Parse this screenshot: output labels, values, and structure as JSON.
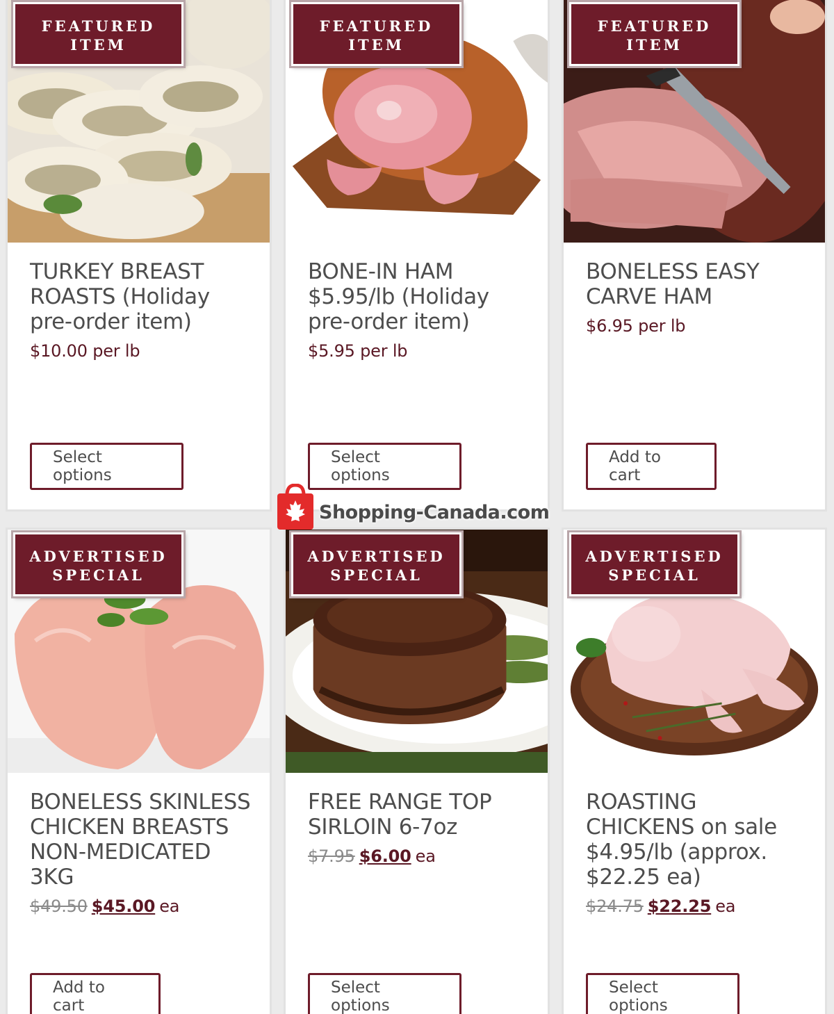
{
  "products": [
    {
      "badge": [
        "FEATURED",
        "ITEM"
      ],
      "title": "TURKEY BREAST ROASTS (Holiday pre-order item)",
      "price": "$10.00 per lb",
      "button": "Select options"
    },
    {
      "badge": [
        "FEATURED",
        "ITEM"
      ],
      "title": "BONE-IN HAM $5.95/lb (Holiday pre-order item)",
      "price": "$5.95 per lb",
      "button": "Select options"
    },
    {
      "badge": [
        "FEATURED",
        "ITEM"
      ],
      "title": "BONELESS EASY CARVE HAM",
      "price": "$6.95 per lb",
      "button": "Add to cart"
    },
    {
      "badge": [
        "ADVERTISED",
        "SPECIAL"
      ],
      "title": "BONELESS SKINLESS CHICKEN BREASTS NON-MEDICATED 3KG",
      "price_old": "$49.50",
      "price_new": "$45.00",
      "price_unit": "ea",
      "button": "Add to cart"
    },
    {
      "badge": [
        "ADVERTISED",
        "SPECIAL"
      ],
      "title": "FREE RANGE TOP SIRLOIN 6-7oz",
      "price_old": "$7.95",
      "price_new": "$6.00",
      "price_unit": "ea",
      "button": "Select options"
    },
    {
      "badge": [
        "ADVERTISED",
        "SPECIAL"
      ],
      "title": "ROASTING CHICKENS on sale $4.95/lb (approx. $22.25 ea)",
      "price_old": "$24.75",
      "price_new": "$22.25",
      "price_unit": "ea",
      "button": "Select options"
    }
  ],
  "watermark": {
    "text": "Shopping-Canada.com"
  },
  "colors": {
    "brand": "#6e1c2a",
    "price": "#5a1824",
    "title": "#4d4d4d"
  }
}
